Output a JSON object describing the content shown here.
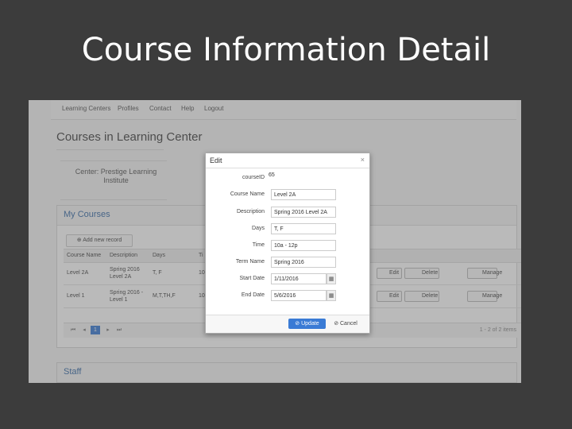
{
  "slide": {
    "title": "Course Information Detail"
  },
  "nav": {
    "items": [
      "Learning Centers",
      "Profiles",
      "Contact",
      "Help",
      "Logout"
    ]
  },
  "page": {
    "heading": "Courses in Learning Center",
    "center_name": "Center: Prestige Learning Institute"
  },
  "courses_panel": {
    "title": "My Courses",
    "add_button": "Add new record",
    "columns": [
      "Course Name",
      "Description",
      "Days",
      "Ti"
    ],
    "rows": [
      {
        "name": "Level 2A",
        "description": "Spring 2016 Level 2A",
        "days": "T, F",
        "time": "10",
        "edit": "Edit",
        "delete": "Delete",
        "manage": "Manage"
      },
      {
        "name": "Level 1",
        "description": "Spring 2016 - Level 1",
        "days": "M,T,TH,F",
        "time": "10",
        "edit": "Edit",
        "delete": "Delete",
        "manage": "Manage"
      }
    ],
    "pager": {
      "first": "⏮",
      "prev": "◂",
      "current": "1",
      "next": "▸",
      "last": "⏭",
      "info": "1 - 2 of 2 items"
    }
  },
  "staff_panel": {
    "title": "Staff"
  },
  "edit_dialog": {
    "title": "Edit",
    "close": "×",
    "fields": {
      "course_id_label": "courseID",
      "course_id": "65",
      "course_name_label": "Course Name",
      "course_name": "Level 2A",
      "description_label": "Description",
      "description": "Spring 2016 Level 2A",
      "days_label": "Days",
      "days": "T, F",
      "time_label": "Time",
      "time": "10a - 12p",
      "term_name_label": "Term Name",
      "term_name": "Spring 2016",
      "start_date_label": "Start Date",
      "start_date": "1/11/2016",
      "end_date_label": "End Date",
      "end_date": "5/6/2016"
    },
    "update_button": "Update",
    "cancel_button": "Cancel",
    "calendar_icon": "calendar-icon"
  }
}
